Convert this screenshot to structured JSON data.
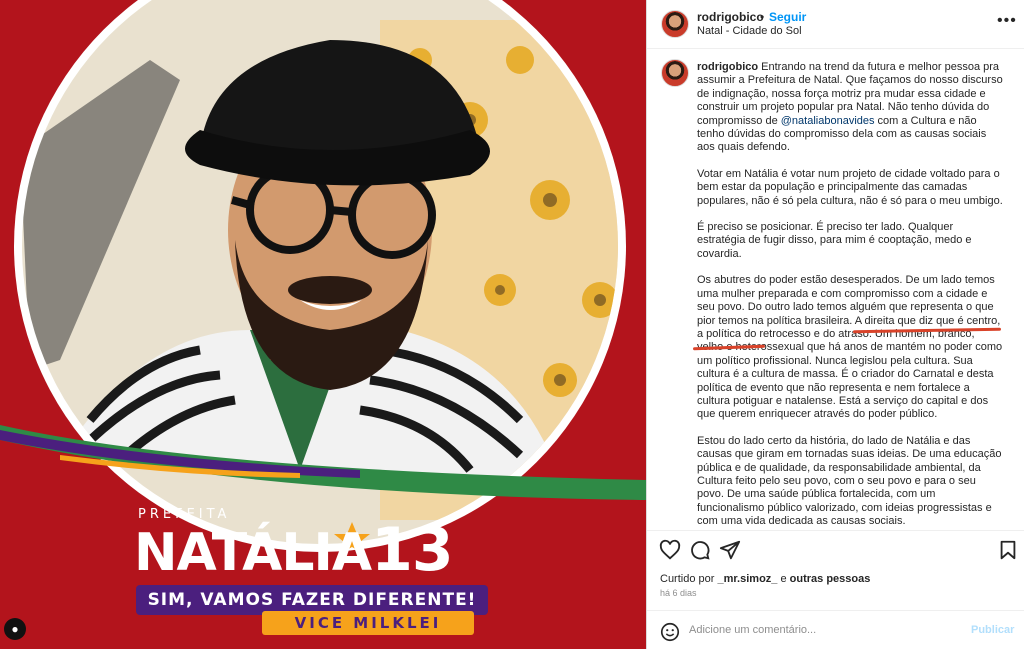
{
  "post": {
    "campaign": {
      "prefeita": "PREFEITA",
      "name": "NATÁLIA",
      "number": "13",
      "slogan": "SIM, VAMOS FAZER DIFERENTE!",
      "vice": "VICE MILKLEI"
    }
  },
  "header": {
    "username": "rodrigobico",
    "dot": "•",
    "follow": "Seguir",
    "location": "Natal - Cidade do Sol",
    "more": "•••"
  },
  "caption": {
    "username": "rodrigobico",
    "p1_a": "Entrando na trend da futura e melhor pessoa pra assumir a Prefeitura de Natal. Que façamos do nosso discurso de indignação, nossa força motriz pra mudar essa cidade e construir um projeto popular pra Natal. Não tenho dúvida do compromisso de ",
    "mention": "@nataliabonavides",
    "p1_b": " com a Cultura e não tenho dúvidas do compromisso dela com as causas sociais aos quais defendo.",
    "p2": "Votar em Natália é votar num projeto de cidade voltado para o bem estar da população e principalmente das camadas populares, não é só pela cultura, não é só para o meu umbigo.",
    "p3": "É preciso se posicionar. É preciso ter lado. Qualquer estratégia de fugir disso, para mim é cooptação, medo e covardia.",
    "p4": "Os abutres do poder estão desesperados. De um lado temos uma mulher preparada e com compromisso com a cidade e seu povo. Do outro lado temos alguém que representa o que pior temos na política brasileira. A direita que diz que é centro, a política do retrocesso e do atraso. Um homem, branco, velho e heterossexual que há anos de mantém no poder como um político profissional. Nunca legislou pela cultura. Sua cultura é a cultura de massa. É o criador do Carnatal e desta política de evento que não representa e nem fortalece a cultura potiguar e natalense. Está a serviço do capital e dos que querem enriquecer através do poder público.",
    "p5": "Estou do lado certo da história, do lado de Natália e das causas que giram em tornadas suas ideias. De uma educação pública e de qualidade, da responsabilidade ambiental, da Cultura feito pelo seu povo, com o seu povo e para o seu povo. De uma saúde pública fortalecida, com um funcionalismo público valorizado, com ideias progressistas e com uma vida dedicada as causas sociais."
  },
  "actions": {
    "liked_prefix": "Curtido por ",
    "liked_user": "_mr.simoz_",
    "liked_middle": " e ",
    "liked_others": "outras pessoas",
    "time_ago": "há 6 dias",
    "comment_placeholder": "Adicione um comentário...",
    "publish": "Publicar"
  },
  "colors": {
    "campaign_red": "#b3141c",
    "slogan_purple": "#4b1f7e",
    "vice_orange": "#f6a21b",
    "follow_blue": "#0095f6",
    "underline_red": "#d9432a"
  },
  "icons": [
    "heart-icon",
    "comment-icon",
    "share-icon",
    "bookmark-icon",
    "emoji-icon",
    "more-options-icon",
    "user-tag-icon"
  ]
}
